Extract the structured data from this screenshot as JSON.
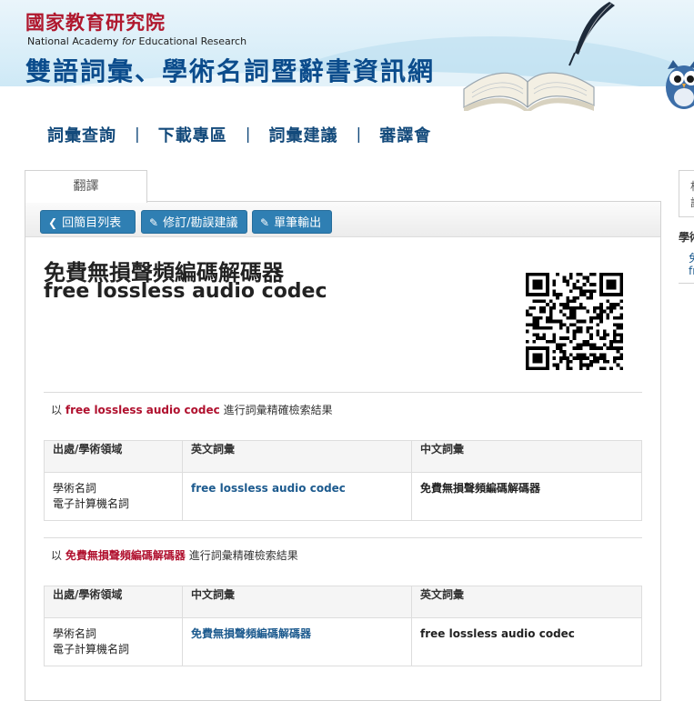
{
  "header": {
    "org_cn": "國家教育研究院",
    "org_en_pre": "National Academy ",
    "org_en_italic": "for",
    "org_en_post": " Educational Research",
    "site_title": "雙語詞彙、學術名詞暨辭書資訊網",
    "icons": [
      "open-book-icon",
      "quill-icon",
      "owl-mascot-icon"
    ]
  },
  "nav": {
    "items": [
      "詞彙查詢",
      "下載專區",
      "詞彙建議",
      "審譯會"
    ],
    "separator": "|"
  },
  "tab": {
    "label": "翻譯"
  },
  "toolbar": {
    "back": {
      "label": "回簡目列表",
      "icon": "chevron-left-icon"
    },
    "suggest": {
      "label": "修訂/勘誤建議",
      "icon": "pencil-icon"
    },
    "export": {
      "label": "單筆輸出",
      "icon": "pencil-icon"
    }
  },
  "term": {
    "chinese": "免費無損聲頻編碼解碼器",
    "english": "free lossless audio codec",
    "qr_icon": "qr-code-icon"
  },
  "search_en": {
    "prefix": "以",
    "query": "free lossless audio codec",
    "suffix": "進行詞彙精確檢索結果",
    "headers": [
      "出處/學術領域",
      "英文詞彙",
      "中文詞彙"
    ],
    "row": {
      "source1": "學術名詞",
      "source2": "電子計算機名詞",
      "term": "free lossless audio codec",
      "translation": "免費無損聲頻編碼解碼器"
    }
  },
  "search_cn": {
    "prefix": "以",
    "query": "免費無損聲頻編碼解碼器",
    "suffix": "進行詞彙精確檢索結果",
    "headers": [
      "出處/學術領域",
      "中文詞彙",
      "英文詞彙"
    ],
    "row": {
      "source1": "學術名詞",
      "source2": "電子計算機名詞",
      "term": "免費無損聲頻編碼解碼器",
      "translation": "free lossless audio codec"
    }
  },
  "side": {
    "box_text_1": "相",
    "box_text_2": "詞",
    "heading": "學術",
    "link1": "免",
    "link2": "fr"
  },
  "colors": {
    "accent_red": "#b0102e",
    "nav_blue": "#134a7b",
    "button_blue": "#2f7fb3",
    "link_blue": "#1c5a8e"
  }
}
